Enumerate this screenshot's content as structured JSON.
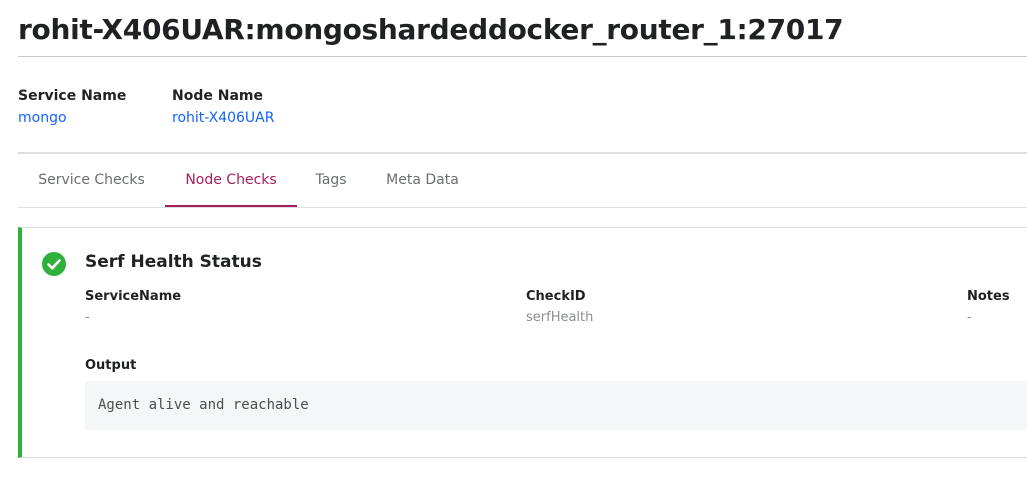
{
  "page": {
    "title": "rohit-X406UAR:mongoshardeddocker_router_1:27017"
  },
  "meta": {
    "service_name_label": "Service Name",
    "service_name_value": "mongo",
    "node_name_label": "Node Name",
    "node_name_value": "rohit-X406UAR"
  },
  "tabs": [
    {
      "label": "Service Checks",
      "active": false
    },
    {
      "label": "Node Checks",
      "active": true
    },
    {
      "label": "Tags",
      "active": false
    },
    {
      "label": "Meta Data",
      "active": false
    }
  ],
  "check": {
    "status": "passing",
    "status_icon": "check-circle-icon",
    "status_color": "#2eb039",
    "title": "Serf Health Status",
    "fields": {
      "service_name_label": "ServiceName",
      "service_name_value": "-",
      "check_id_label": "CheckID",
      "check_id_value": "serfHealth",
      "notes_label": "Notes",
      "notes_value": "-"
    },
    "output_label": "Output",
    "output_value": "Agent alive and reachable"
  },
  "colors": {
    "link": "#1563ff",
    "active_tab": "#a41f5b",
    "passing": "#2eb039"
  }
}
